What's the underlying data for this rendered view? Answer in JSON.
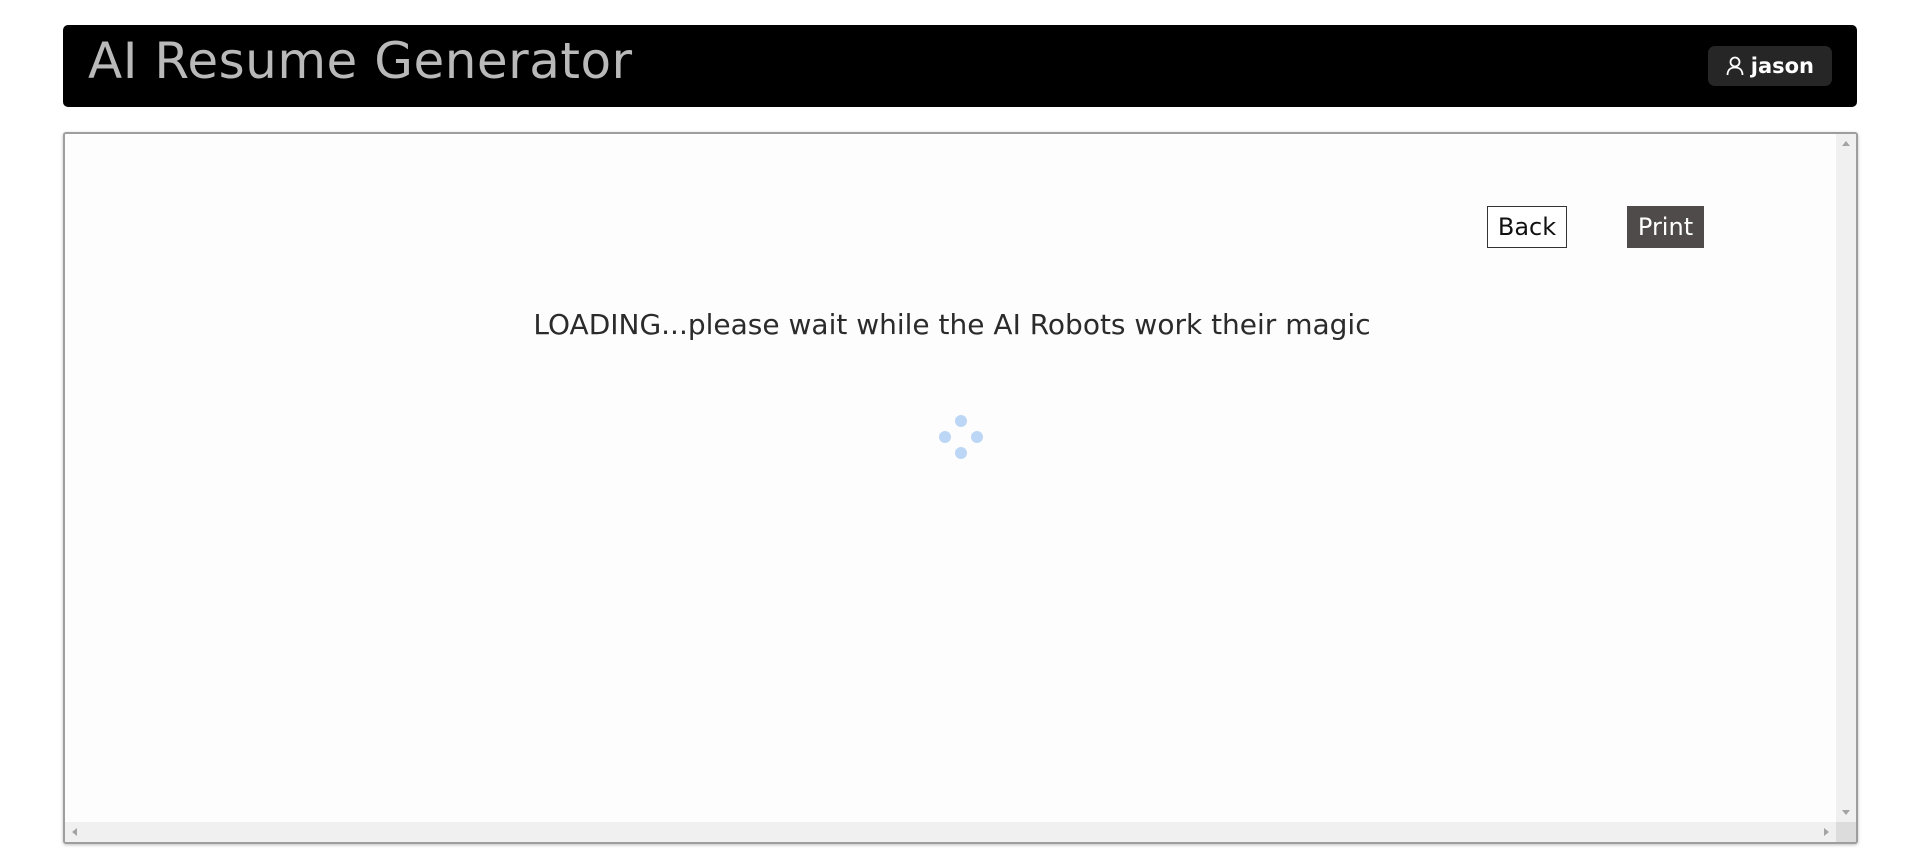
{
  "app": {
    "title": "AI Resume Generator"
  },
  "user": {
    "name": "jason",
    "icon": "user-icon"
  },
  "toolbar": {
    "back_label": "Back",
    "print_label": "Print"
  },
  "status": {
    "loading_message": "LOADING...please wait while the AI Robots work their magic"
  },
  "spinner": {
    "icon": "loading-spinner-icon",
    "color": "#bcd6f5"
  },
  "colors": {
    "header_bg": "#000000",
    "title_text": "#b9b9b9",
    "user_button_bg": "#262626",
    "print_button_bg": "#504b4b"
  }
}
